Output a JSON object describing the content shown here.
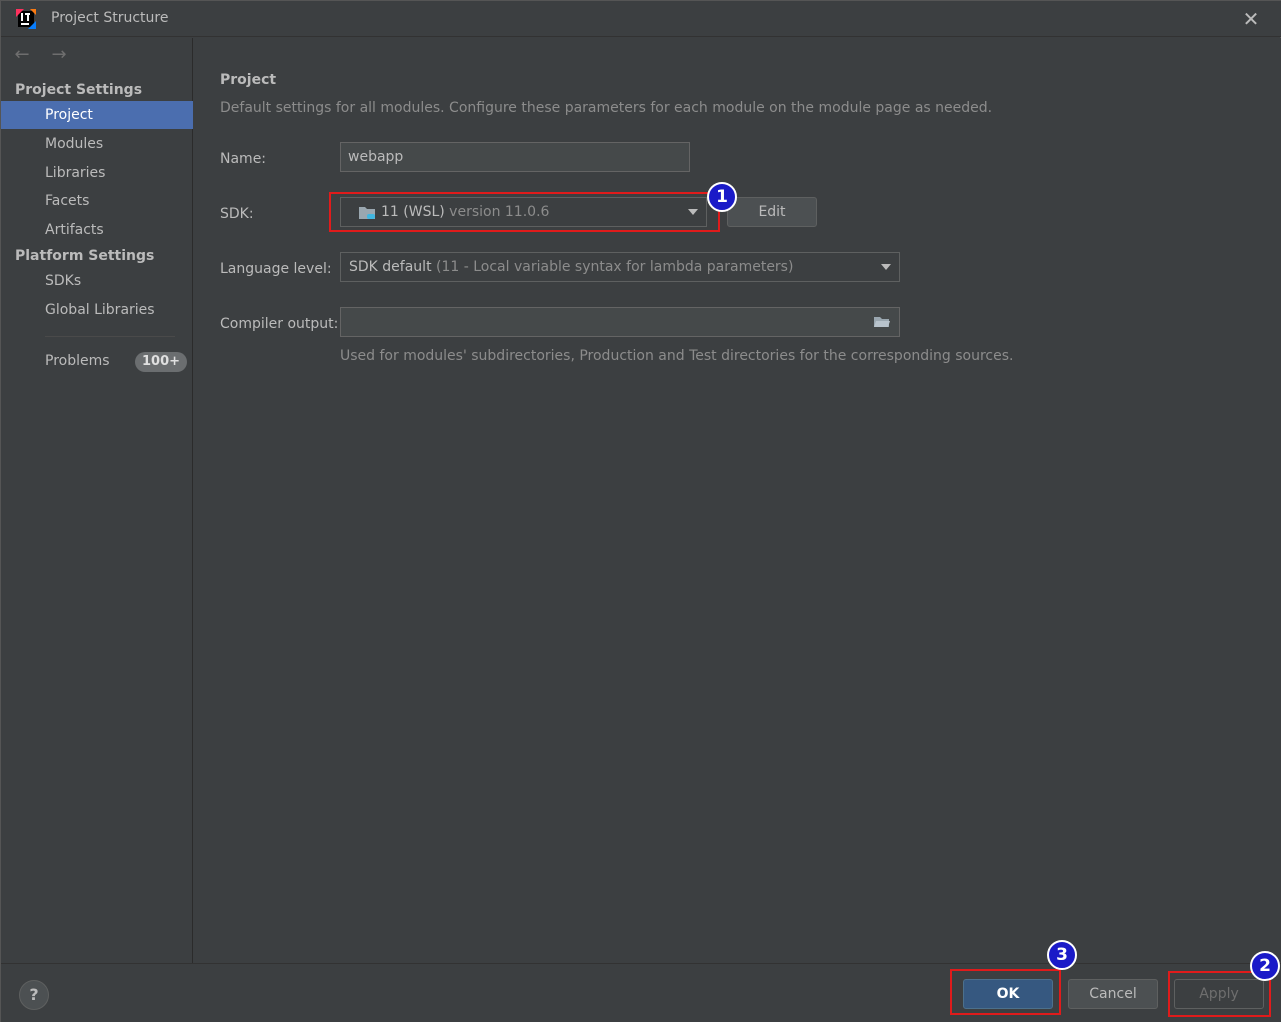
{
  "window": {
    "title": "Project Structure",
    "close_glyph": "✕"
  },
  "nav": {
    "back": "←",
    "forward": "→"
  },
  "sidebar": {
    "project_settings_header": "Project Settings",
    "project_items": [
      "Project",
      "Modules",
      "Libraries",
      "Facets",
      "Artifacts"
    ],
    "platform_settings_header": "Platform Settings",
    "platform_items": [
      "SDKs",
      "Global Libraries"
    ],
    "problems_label": "Problems",
    "problems_badge": "100+",
    "selected": "Project"
  },
  "main": {
    "heading": "Project",
    "description": "Default settings for all modules. Configure these parameters for each module on the module page as needed.",
    "name_label": "Name:",
    "name_value": "webapp",
    "sdk_label": "SDK:",
    "sdk_name": "11 (WSL)",
    "sdk_version": "version 11.0.6",
    "edit_label": "Edit",
    "language_level_label": "Language level:",
    "language_level_value": "SDK default",
    "language_level_detail": "(11 - Local variable syntax for lambda parameters)",
    "compiler_output_label": "Compiler output:",
    "compiler_output_value": "",
    "compiler_output_hint": "Used for modules' subdirectories, Production and Test directories for the corresponding sources."
  },
  "footer": {
    "help_glyph": "?",
    "ok_label": "OK",
    "cancel_label": "Cancel",
    "apply_label": "Apply"
  },
  "annotations": {
    "marker_1": "1",
    "marker_2": "2",
    "marker_3": "3"
  },
  "colors": {
    "background": "#3c3f41",
    "selection": "#4b6eaf",
    "ok_button": "#365880",
    "annotation_box": "#e01b1b",
    "annotation_marker": "#1a1ac8"
  },
  "icons": {
    "app": "intellij-idea-logo",
    "sdk": "folder-sdk-icon",
    "compiler_browse": "folder-open-icon"
  }
}
